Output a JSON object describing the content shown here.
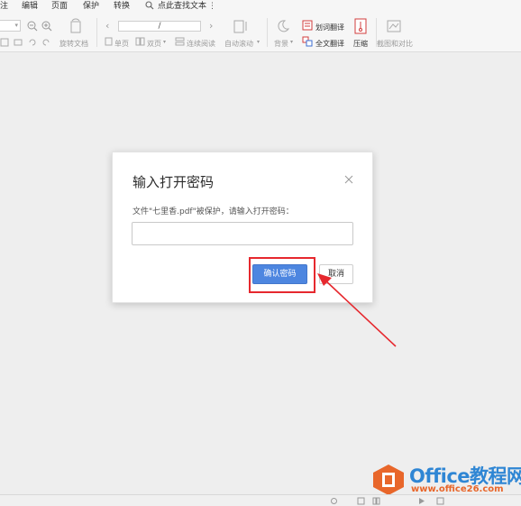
{
  "menu": {
    "items": [
      "注",
      "编辑",
      "页面",
      "保护",
      "转换"
    ],
    "search_label": "点此查找文本"
  },
  "toolbar": {
    "rotate_label": "旋转文档",
    "single_page_label": "单页",
    "double_page_label": "双页",
    "continuous_label": "连续阅读",
    "auto_scroll_label": "自动滚动",
    "background_label": "背景",
    "word_translate_label": "划词翻译",
    "full_translate_label": "全文翻译",
    "compress_label": "压缩",
    "screenshot_compare_label": "截图和对比",
    "page_value": "/"
  },
  "dialog": {
    "title": "输入打开密码",
    "message": "文件\"七里香.pdf\"被保护，请输入打开密码：",
    "password_value": "",
    "confirm_label": "确认密码",
    "cancel_label": "取消"
  },
  "watermark": {
    "title": "Office教程网",
    "url": "www.office26.com"
  },
  "colors": {
    "accent": "#4d86e0",
    "highlight": "#e6282e",
    "watermark_blue": "#2f86d4",
    "watermark_orange": "#e8662a"
  }
}
